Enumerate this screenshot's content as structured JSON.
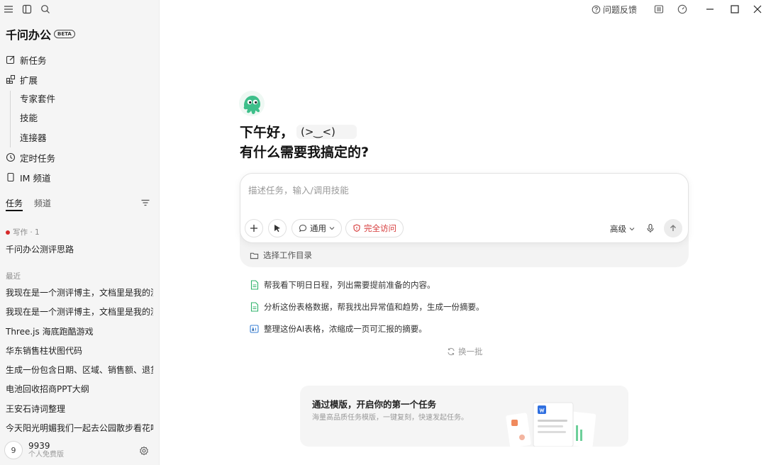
{
  "app": {
    "name": "千问办公",
    "badge": "BETA"
  },
  "titlebar": {
    "feedback_label": "问题反馈"
  },
  "nav": {
    "new_task": "新任务",
    "extensions": "扩展",
    "sub": [
      "专家套件",
      "技能",
      "连接器"
    ],
    "scheduled": "定时任务",
    "im_channel": "IM 频道"
  },
  "tabs": {
    "tasks": "任务",
    "channels": "频道"
  },
  "writing_section": {
    "label": "写作 · 1",
    "items": [
      "千问办公测评思路"
    ]
  },
  "recent_section": {
    "label": "最近",
    "items": [
      "我现在是一个测评博主，文档里是我的测评思路",
      "我现在是一个测评博主，文档里是我的测评思路",
      "Three.js 海底跑酷游戏",
      "华东销售柱状图代码",
      "生成一份包含日期、区域、销售额、退货率的表格",
      "电池回收招商PPT大纲",
      "王安石诗词整理",
      "今天阳光明媚我们一起去公园散步看花吧"
    ]
  },
  "user": {
    "avatar": "9",
    "name": "9939",
    "plan": "个人免费版"
  },
  "greeting": {
    "line1": "下午好，",
    "kaomoji": "(>‿<)",
    "line2": "有什么需要我搞定的?"
  },
  "input": {
    "placeholder": "描述任务，输入/调用技能",
    "mode_label": "通用",
    "access_label": "完全访问",
    "advanced_label": "高级",
    "workdir_label": "选择工作目录"
  },
  "suggestions": [
    "帮我看下明日日程，列出需要提前准备的内容。",
    "分析这份表格数据，帮我找出异常值和趋势，生成一份摘要。",
    "整理这份AI表格，浓缩成一页可汇报的摘要。"
  ],
  "refresh_label": "换一批",
  "template_card": {
    "title": "通过模版，开启你的第一个任务",
    "subtitle": "海量高品质任务模版，一键复刻，快速发起任务。"
  },
  "colors": {
    "accent_red": "#d63a3a",
    "mascot_green": "#3dbf8a"
  }
}
